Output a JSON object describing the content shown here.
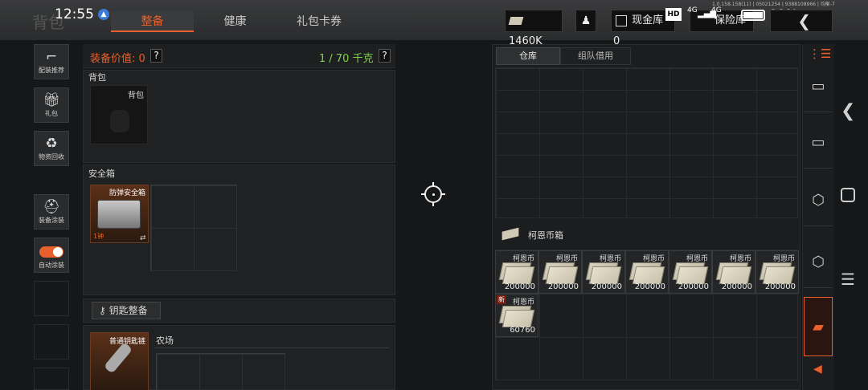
{
  "status_bar": {
    "time": "12:55",
    "battery": "99%",
    "version": "1.0.158.158(11) | 05021254 | 9388108966 | 均衡-7",
    "net1": "4G",
    "net2": "4G",
    "hd": "HD"
  },
  "header": {
    "bg_title": "背包",
    "tabs": [
      {
        "label": "整备",
        "active": true
      },
      {
        "label": "健康"
      },
      {
        "label": "礼包卡券"
      }
    ],
    "currency": {
      "amount": "1460K"
    },
    "cash_button": {
      "label": "现金库"
    },
    "cash_count": "0",
    "insurance_button": {
      "label": "保险库"
    }
  },
  "left_nav": [
    {
      "label": "配装推荐",
      "icon": "gun-icon"
    },
    {
      "label": "礼包",
      "icon": "gift-icon"
    },
    {
      "label": "物资回收",
      "icon": "recycle-icon"
    },
    {
      "label": "装备涂装",
      "icon": "helmet-icon"
    },
    {
      "label": "自动涂装",
      "icon": "toggle-icon"
    }
  ],
  "equipment": {
    "value_label": "装备价值: 0",
    "weight_label": "1 / 70 千克",
    "help": "?",
    "backpack_section": "背包",
    "backpack_slot": "背包",
    "safe_section": "安全箱",
    "safe_item_name": "防弹安全箱",
    "safe_item_sub": "1钟",
    "key_button": "钥匙整备",
    "key_item_name": "普通钥匙链",
    "key_map": "农场"
  },
  "storage": {
    "tabs": [
      {
        "label": "仓库",
        "active": true
      },
      {
        "label": "组队借用"
      }
    ],
    "coin_box_label": "柯恩币箱",
    "coins": [
      {
        "name": "柯恩币",
        "amount": "200000"
      },
      {
        "name": "柯恩币",
        "amount": "200000"
      },
      {
        "name": "柯恩币",
        "amount": "200000"
      },
      {
        "name": "柯恩币",
        "amount": "200000"
      },
      {
        "name": "柯恩币",
        "amount": "200000"
      },
      {
        "name": "柯恩币",
        "amount": "200000"
      },
      {
        "name": "柯恩币",
        "amount": "200000"
      },
      {
        "name": "柯恩币",
        "amount": "60760",
        "new_tag": "新"
      }
    ]
  },
  "colors": {
    "accent": "#e8602c",
    "green": "#7fd14a",
    "panel": "#202122"
  }
}
